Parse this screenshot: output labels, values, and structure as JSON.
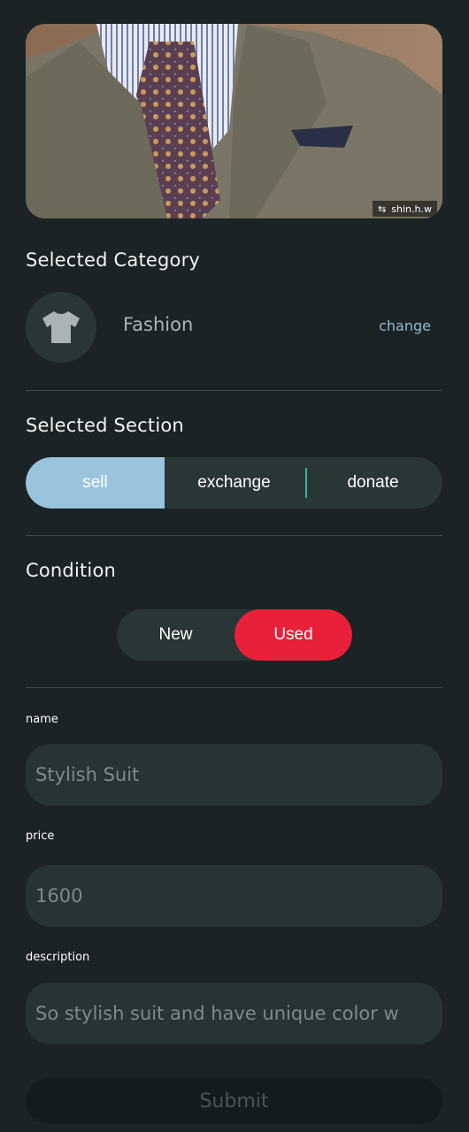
{
  "photo": {
    "watermark": "shin.h.w"
  },
  "category": {
    "title": "Selected Category",
    "name": "Fashion",
    "change_label": "change",
    "icon": "tshirt-icon"
  },
  "section": {
    "title": "Selected Section",
    "options": [
      "sell",
      "exchange",
      "donate"
    ],
    "selected": "sell"
  },
  "condition": {
    "title": "Condition",
    "options": [
      "New",
      "Used"
    ],
    "selected": "Used"
  },
  "form": {
    "name_label": "name",
    "name_value": "Stylish Suit",
    "price_label": "price",
    "price_value": "1600",
    "description_label": "description",
    "description_value": "So stylish suit and have unique color w"
  },
  "submit_label": "Submit",
  "colors": {
    "background": "#1b2325",
    "accent_blue": "#9ac3de",
    "accent_red": "#e8203a",
    "link": "#8fb9d3"
  }
}
